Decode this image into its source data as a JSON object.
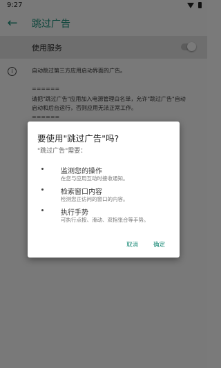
{
  "status": {
    "time": "9:27"
  },
  "toolbar": {
    "title": "跳过广告"
  },
  "service": {
    "label": "使用服务",
    "enabled": false
  },
  "content": {
    "desc1": "自动跳过第三方应用启动界面的广告。",
    "desc2": "======",
    "desc3": "请把\"跳过广告\"应用加入电源管理白名单，允许\"跳过广告\"自动",
    "desc4": "启动和后台运行，否则应用无法正常工作。",
    "desc5": "======"
  },
  "dialog": {
    "title": "要使用\"跳过广告\"吗?",
    "subtitle": "\"跳过广告\"需要：",
    "permissions": [
      {
        "title": "监测您的操作",
        "desc": "在您与应用互动时接收通知。"
      },
      {
        "title": "检索窗口内容",
        "desc": "检测您正访问的窗口的内容。"
      },
      {
        "title": "执行手势",
        "desc": "可执行点按、滑动、双指张合等手势。"
      }
    ],
    "cancel": "取消",
    "ok": "确定"
  }
}
